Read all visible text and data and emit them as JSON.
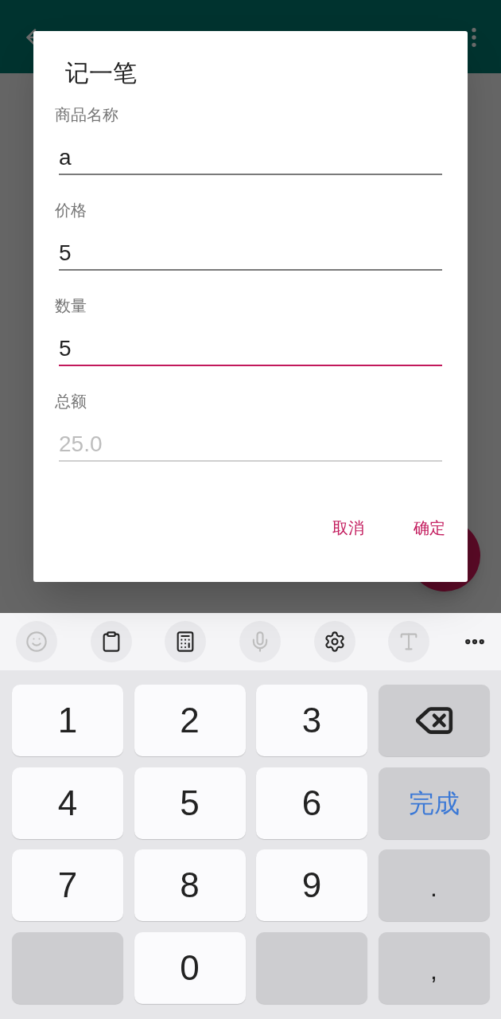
{
  "dialog": {
    "title": "记一笔",
    "fields": [
      {
        "label": "商品名称",
        "value": "a",
        "focused": false,
        "disabled": false
      },
      {
        "label": "价格",
        "value": "5",
        "focused": false,
        "disabled": false
      },
      {
        "label": "数量",
        "value": "5",
        "focused": true,
        "disabled": false
      },
      {
        "label": "总额",
        "value": "25.0",
        "focused": false,
        "disabled": true
      }
    ],
    "buttons": [
      "取消",
      "确定"
    ]
  },
  "keyboard": {
    "toolbar": [
      {
        "kind": "emoji",
        "disabled": true
      },
      {
        "kind": "clipboard",
        "disabled": false
      },
      {
        "kind": "calculator",
        "disabled": false
      },
      {
        "kind": "mic",
        "disabled": true
      },
      {
        "kind": "settings",
        "disabled": false
      },
      {
        "kind": "handwriting",
        "disabled": true
      },
      {
        "kind": "more",
        "disabled": false
      }
    ],
    "keys": [
      {
        "kind": "char",
        "label": "1"
      },
      {
        "kind": "char",
        "label": "2"
      },
      {
        "kind": "char",
        "label": "3"
      },
      {
        "kind": "backspace"
      },
      {
        "kind": "char",
        "label": "4"
      },
      {
        "kind": "char",
        "label": "5"
      },
      {
        "kind": "char",
        "label": "6"
      },
      {
        "kind": "done",
        "label": "完成"
      },
      {
        "kind": "char",
        "label": "7"
      },
      {
        "kind": "char",
        "label": "8"
      },
      {
        "kind": "char",
        "label": "9"
      },
      {
        "kind": "symbol",
        "label": "."
      },
      {
        "kind": "blank"
      },
      {
        "kind": "char",
        "label": "0"
      },
      {
        "kind": "blank"
      },
      {
        "kind": "symbol",
        "label": ","
      }
    ]
  }
}
